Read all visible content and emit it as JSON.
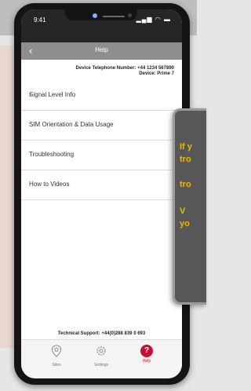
{
  "status_bar": {
    "time": "9:41"
  },
  "header": {
    "back_icon": "chevron-left-icon",
    "title": "Help"
  },
  "device_info": {
    "line1": "Device Telephone Number: +44 1234 567890",
    "line2": "Device: Prime 7"
  },
  "menu": {
    "items": [
      {
        "label": "Signal Level Info",
        "has_chevron": true,
        "chevron": "›"
      },
      {
        "label": "SIM Orientation & Data Usage"
      },
      {
        "label": "Troubleshooting"
      },
      {
        "label": "How to Videos"
      }
    ]
  },
  "support": {
    "text": "Technical Support: +44(0)288 839 0 693"
  },
  "tabs": [
    {
      "label": "Sites",
      "icon": "map-pin-icon"
    },
    {
      "label": "Settings",
      "icon": "gear-icon"
    },
    {
      "label": "Help",
      "icon": "question-icon",
      "active": true,
      "glyph": "?"
    }
  ],
  "tooltip": {
    "lines": [
      "If y",
      "tro",
      "tro",
      "V",
      "yo"
    ]
  },
  "colors": {
    "accent": "#c8102e",
    "tooltip_text": "#f2b705",
    "tooltip_bg": "#575757"
  }
}
